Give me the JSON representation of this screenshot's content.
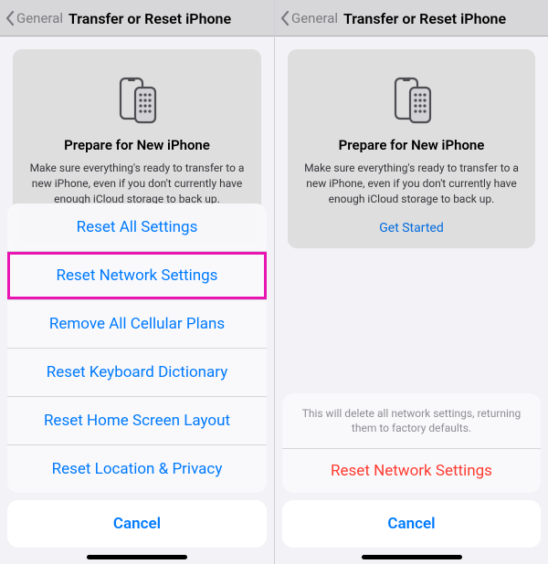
{
  "nav": {
    "back_label": "General",
    "title": "Transfer or Reset iPhone"
  },
  "card": {
    "title": "Prepare for New iPhone",
    "body": "Make sure everything's ready to transfer to a new iPhone, even if you don't currently have enough iCloud storage to back up.",
    "link": "Get Started"
  },
  "left_sheet": {
    "items": [
      {
        "label": "Reset All Settings"
      },
      {
        "label": "Reset Network Settings"
      },
      {
        "label": "Remove All Cellular Plans"
      },
      {
        "label": "Reset Keyboard Dictionary"
      },
      {
        "label": "Reset Home Screen Layout"
      },
      {
        "label": "Reset Location & Privacy"
      }
    ],
    "cancel": "Cancel"
  },
  "right_sheet": {
    "message": "This will delete all network settings, returning them to factory defaults.",
    "action": "Reset Network Settings",
    "cancel": "Cancel"
  }
}
